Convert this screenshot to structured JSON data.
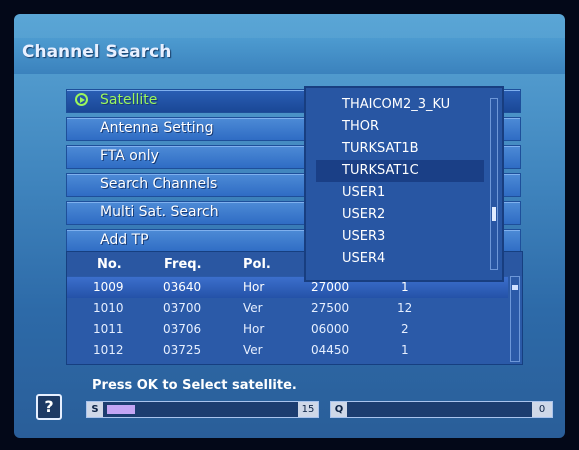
{
  "screen": {
    "title": "Channel Search"
  },
  "menu": {
    "items": [
      {
        "label": "Satellite",
        "selected": true
      },
      {
        "label": "Antenna Setting"
      },
      {
        "label": "FTA only"
      },
      {
        "label": "Search Channels"
      },
      {
        "label": "Multi Sat. Search"
      },
      {
        "label": "Add TP"
      }
    ]
  },
  "dropdown": {
    "options": [
      "THAICOM2_3_KU",
      "THOR",
      "TURKSAT1B",
      "TURKSAT1C",
      "USER1",
      "USER2",
      "USER3",
      "USER4"
    ],
    "active_index": 3,
    "scroll_position_fraction": 0.7
  },
  "table": {
    "headers": [
      "No.",
      "Freq.",
      "Pol."
    ],
    "rows": [
      {
        "no": "1009",
        "freq": "03640",
        "pol": "Hor",
        "sr": "27000",
        "ch": "1"
      },
      {
        "no": "1010",
        "freq": "03700",
        "pol": "Ver",
        "sr": "27500",
        "ch": "12"
      },
      {
        "no": "1011",
        "freq": "03706",
        "pol": "Hor",
        "sr": "06000",
        "ch": "2"
      },
      {
        "no": "1012",
        "freq": "03725",
        "pol": "Ver",
        "sr": "04450",
        "ch": "1"
      }
    ],
    "highlighted_row": 0
  },
  "status": {
    "message": "Press OK to Select satellite.",
    "signal": {
      "label": "S",
      "value": "15",
      "level_percent": 15,
      "fill_color": "#c3a5f4"
    },
    "quality": {
      "label": "Q",
      "value": "0",
      "level_percent": 0
    }
  },
  "icons": {
    "help": "help-question-icon",
    "selector": "play-circle-icon"
  },
  "colors": {
    "accent_green": "#9cf65c",
    "panel_blue": "#2b5aa8"
  }
}
